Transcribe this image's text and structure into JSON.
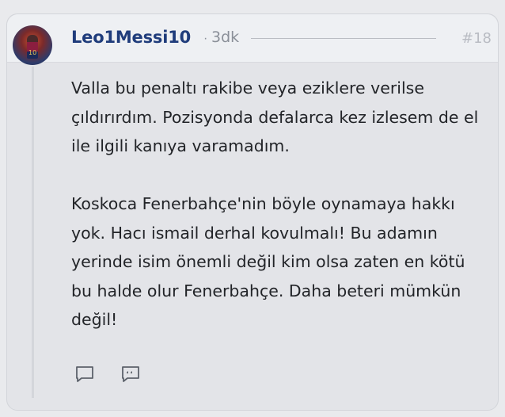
{
  "post": {
    "username": "Leo1Messi10",
    "separator": "·",
    "time": "3dk",
    "post_number": "#18",
    "paragraphs": [
      "Valla bu penaltı rakibe veya eziklere verilse çıldırırdım. Pozisyonda defalarca kez izlesem de el ile ilgili kanıya varamadım.",
      "Koskoca Fenerbahçe'nin böyle oynamaya hakkı yok. Hacı ismail derhal kovulmalı! Bu adamın yerinde isim önemli değil kim olsa zaten en kötü bu halde olur Fenerbahçe. Daha beteri mümkün değil!"
    ]
  },
  "actions": {
    "reply_icon": "comment-icon",
    "quote_icon": "quote-icon"
  },
  "colors": {
    "username": "#1f3c7b",
    "muted": "#8a8f98",
    "text": "#222428",
    "card_bg": "#e3e4e8"
  }
}
